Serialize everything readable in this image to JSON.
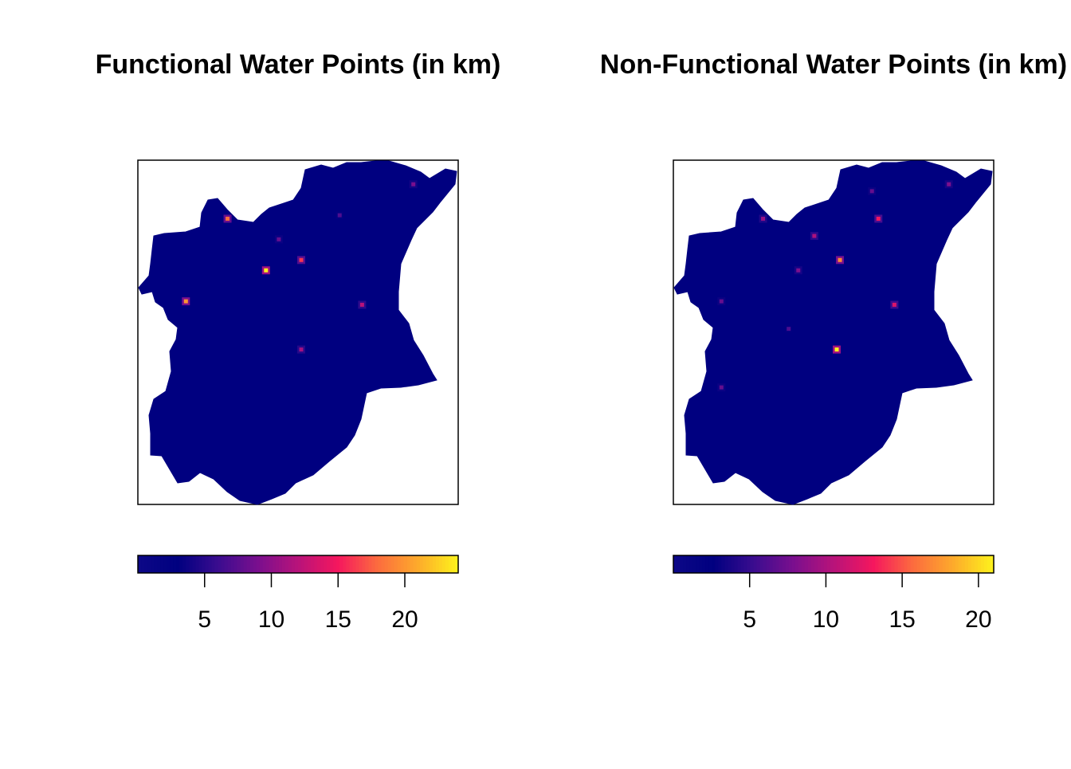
{
  "panels": [
    {
      "title": "Functional Water Points (in km)",
      "legend": {
        "min": 0,
        "max": 24,
        "ticks": [
          5,
          10,
          15,
          20
        ]
      },
      "hotspots": [
        {
          "lon_frac": 0.28,
          "lat_frac": 0.17,
          "value": 18
        },
        {
          "lon_frac": 0.4,
          "lat_frac": 0.32,
          "value": 24
        },
        {
          "lon_frac": 0.51,
          "lat_frac": 0.29,
          "value": 16
        },
        {
          "lon_frac": 0.15,
          "lat_frac": 0.41,
          "value": 20
        },
        {
          "lon_frac": 0.7,
          "lat_frac": 0.42,
          "value": 12
        },
        {
          "lon_frac": 0.51,
          "lat_frac": 0.55,
          "value": 11
        },
        {
          "lon_frac": 0.86,
          "lat_frac": 0.07,
          "value": 9
        },
        {
          "lon_frac": 0.44,
          "lat_frac": 0.23,
          "value": 8
        },
        {
          "lon_frac": 0.63,
          "lat_frac": 0.16,
          "value": 7
        }
      ]
    },
    {
      "title": "Non-Functional Water Points (in km)",
      "legend": {
        "min": 0,
        "max": 21,
        "ticks": [
          5,
          10,
          15,
          20
        ]
      },
      "hotspots": [
        {
          "lon_frac": 0.51,
          "lat_frac": 0.55,
          "value": 21
        },
        {
          "lon_frac": 0.52,
          "lat_frac": 0.29,
          "value": 17
        },
        {
          "lon_frac": 0.64,
          "lat_frac": 0.17,
          "value": 13
        },
        {
          "lon_frac": 0.69,
          "lat_frac": 0.42,
          "value": 12
        },
        {
          "lon_frac": 0.44,
          "lat_frac": 0.22,
          "value": 10
        },
        {
          "lon_frac": 0.28,
          "lat_frac": 0.17,
          "value": 9
        },
        {
          "lon_frac": 0.39,
          "lat_frac": 0.32,
          "value": 8
        },
        {
          "lon_frac": 0.15,
          "lat_frac": 0.41,
          "value": 7
        },
        {
          "lon_frac": 0.86,
          "lat_frac": 0.07,
          "value": 8
        },
        {
          "lon_frac": 0.62,
          "lat_frac": 0.09,
          "value": 7
        },
        {
          "lon_frac": 0.15,
          "lat_frac": 0.66,
          "value": 7
        },
        {
          "lon_frac": 0.36,
          "lat_frac": 0.49,
          "value": 6
        }
      ]
    }
  ],
  "colors": {
    "palette": [
      "#0d0887",
      "#000080",
      "#3a0c8f",
      "#7a0f8e",
      "#b8137a",
      "#f5175e",
      "#fc6d3e",
      "#fdab2b",
      "#fdf31c"
    ],
    "background": "#ffffff",
    "frame": "#000000"
  }
}
